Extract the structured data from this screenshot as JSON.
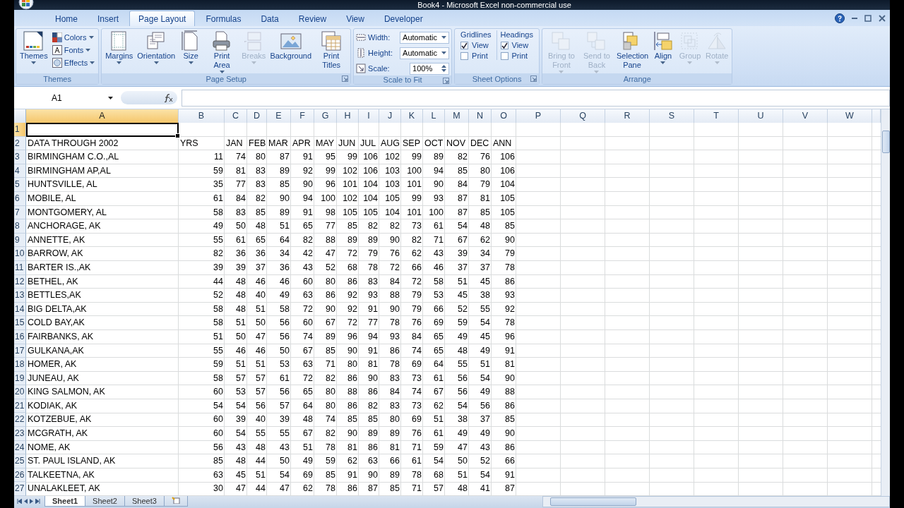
{
  "window": {
    "title": "Book4 - Microsoft Excel non-commercial use"
  },
  "ribbon_tabs": [
    {
      "label": "Home",
      "selected": false
    },
    {
      "label": "Insert",
      "selected": false
    },
    {
      "label": "Page Layout",
      "selected": true
    },
    {
      "label": "Formulas",
      "selected": false
    },
    {
      "label": "Data",
      "selected": false
    },
    {
      "label": "Review",
      "selected": false
    },
    {
      "label": "View",
      "selected": false
    },
    {
      "label": "Developer",
      "selected": false
    }
  ],
  "ribbon_groups": [
    {
      "title": "Themes",
      "launcher": false,
      "controls": [
        {
          "kind": "large",
          "label": "Themes",
          "dropdown": true,
          "disabled": false
        },
        {
          "kind": "stack",
          "items": [
            {
              "label": "Colors",
              "dropdown": true,
              "disabled": false
            },
            {
              "label": "Fonts",
              "dropdown": true,
              "disabled": false
            },
            {
              "label": "Effects",
              "dropdown": true,
              "disabled": false
            }
          ]
        }
      ]
    },
    {
      "title": "Page Setup",
      "launcher": true,
      "controls": [
        {
          "kind": "large",
          "label": "Margins",
          "dropdown": true,
          "disabled": false
        },
        {
          "kind": "large",
          "label": "Orientation",
          "dropdown": true,
          "disabled": false
        },
        {
          "kind": "large",
          "label": "Size",
          "dropdown": true,
          "disabled": false
        },
        {
          "kind": "large",
          "label": "Print Area",
          "dropdown": true,
          "disabled": false
        },
        {
          "kind": "large",
          "label": "Breaks",
          "dropdown": true,
          "disabled": true
        },
        {
          "kind": "large",
          "label": "Background",
          "dropdown": false,
          "disabled": false
        },
        {
          "kind": "large",
          "label": "Print Titles",
          "dropdown": false,
          "disabled": false
        }
      ]
    },
    {
      "title": "Scale to Fit",
      "launcher": true,
      "controls": [
        {
          "kind": "fields",
          "items": [
            {
              "label": "Width:",
              "value": "Automatic",
              "kind": "dropdown"
            },
            {
              "label": "Height:",
              "value": "Automatic",
              "kind": "dropdown"
            },
            {
              "label": "Scale:",
              "value": "100%",
              "kind": "spin"
            }
          ]
        }
      ]
    },
    {
      "title": "Sheet Options",
      "launcher": true,
      "controls": [
        {
          "kind": "checks",
          "title": "Gridlines",
          "options": [
            {
              "label": "View",
              "checked": true
            },
            {
              "label": "Print",
              "checked": false
            }
          ]
        },
        {
          "kind": "checks",
          "title": "Headings",
          "options": [
            {
              "label": "View",
              "checked": true
            },
            {
              "label": "Print",
              "checked": false
            }
          ]
        }
      ]
    },
    {
      "title": "Arrange",
      "launcher": false,
      "controls": [
        {
          "kind": "large",
          "label": "Bring to Front",
          "dropdown": true,
          "disabled": true
        },
        {
          "kind": "large",
          "label": "Send to Back",
          "dropdown": true,
          "disabled": true
        },
        {
          "kind": "large",
          "label": "Selection Pane",
          "dropdown": false,
          "disabled": false
        },
        {
          "kind": "large",
          "label": "Align",
          "dropdown": true,
          "disabled": false
        },
        {
          "kind": "large",
          "label": "Group",
          "dropdown": true,
          "disabled": true
        },
        {
          "kind": "large",
          "label": "Rotate",
          "dropdown": true,
          "disabled": true
        }
      ]
    }
  ],
  "formula_bar": {
    "name_box": "A1"
  },
  "columns": [
    {
      "label": "A",
      "selected": true
    },
    {
      "label": "B",
      "selected": false
    },
    {
      "label": "C",
      "selected": false
    },
    {
      "label": "D",
      "selected": false
    },
    {
      "label": "E",
      "selected": false
    },
    {
      "label": "F",
      "selected": false
    },
    {
      "label": "G",
      "selected": false
    },
    {
      "label": "H",
      "selected": false
    },
    {
      "label": "I",
      "selected": false
    },
    {
      "label": "J",
      "selected": false
    },
    {
      "label": "K",
      "selected": false
    },
    {
      "label": "L",
      "selected": false
    },
    {
      "label": "M",
      "selected": false
    },
    {
      "label": "N",
      "selected": false
    },
    {
      "label": "O",
      "selected": false
    },
    {
      "label": "P",
      "selected": false
    },
    {
      "label": "Q",
      "selected": false
    },
    {
      "label": "R",
      "selected": false
    },
    {
      "label": "S",
      "selected": false
    },
    {
      "label": "T",
      "selected": false
    },
    {
      "label": "U",
      "selected": false
    },
    {
      "label": "V",
      "selected": false
    },
    {
      "label": "W",
      "selected": false
    }
  ],
  "rows": [
    {
      "number": "1",
      "selected": true,
      "kind": "blank"
    },
    {
      "number": "2",
      "selected": false,
      "kind": "header",
      "cells": [
        "DATA THROUGH 2002",
        "YRS",
        "JAN",
        "FEB",
        "MAR",
        "APR",
        "MAY",
        "JUN",
        "JUL",
        "AUG",
        "SEP",
        "OCT",
        "NOV",
        "DEC",
        "ANN"
      ]
    },
    {
      "number": "3",
      "selected": false,
      "kind": "data",
      "cells": [
        "BIRMINGHAM C.O.,AL",
        "11",
        "74",
        "80",
        "87",
        "91",
        "95",
        "99",
        "106",
        "102",
        "99",
        "89",
        "82",
        "76",
        "106"
      ]
    },
    {
      "number": "4",
      "selected": false,
      "kind": "data",
      "cells": [
        "BIRMINGHAM AP,AL",
        "59",
        "81",
        "83",
        "89",
        "92",
        "99",
        "102",
        "106",
        "103",
        "100",
        "94",
        "85",
        "80",
        "106"
      ]
    },
    {
      "number": "5",
      "selected": false,
      "kind": "data",
      "cells": [
        "HUNTSVILLE, AL",
        "35",
        "77",
        "83",
        "85",
        "90",
        "96",
        "101",
        "104",
        "103",
        "101",
        "90",
        "84",
        "79",
        "104"
      ]
    },
    {
      "number": "6",
      "selected": false,
      "kind": "data",
      "cells": [
        "MOBILE, AL",
        "61",
        "84",
        "82",
        "90",
        "94",
        "100",
        "102",
        "104",
        "105",
        "99",
        "93",
        "87",
        "81",
        "105"
      ]
    },
    {
      "number": "7",
      "selected": false,
      "kind": "data",
      "cells": [
        "MONTGOMERY, AL",
        "58",
        "83",
        "85",
        "89",
        "91",
        "98",
        "105",
        "105",
        "104",
        "101",
        "100",
        "87",
        "85",
        "105"
      ]
    },
    {
      "number": "8",
      "selected": false,
      "kind": "data",
      "cells": [
        "ANCHORAGE, AK",
        "49",
        "50",
        "48",
        "51",
        "65",
        "77",
        "85",
        "82",
        "82",
        "73",
        "61",
        "54",
        "48",
        "85"
      ]
    },
    {
      "number": "9",
      "selected": false,
      "kind": "data",
      "cells": [
        "ANNETTE, AK",
        "55",
        "61",
        "65",
        "64",
        "82",
        "88",
        "89",
        "89",
        "90",
        "82",
        "71",
        "67",
        "62",
        "90"
      ]
    },
    {
      "number": "10",
      "selected": false,
      "kind": "data",
      "cells": [
        "BARROW, AK",
        "82",
        "36",
        "36",
        "34",
        "42",
        "47",
        "72",
        "79",
        "76",
        "62",
        "43",
        "39",
        "34",
        "79"
      ]
    },
    {
      "number": "11",
      "selected": false,
      "kind": "data",
      "cells": [
        "BARTER IS.,AK",
        "39",
        "39",
        "37",
        "36",
        "43",
        "52",
        "68",
        "78",
        "72",
        "66",
        "46",
        "37",
        "37",
        "78"
      ]
    },
    {
      "number": "12",
      "selected": false,
      "kind": "data",
      "cells": [
        "BETHEL, AK",
        "44",
        "48",
        "46",
        "46",
        "60",
        "80",
        "86",
        "83",
        "84",
        "72",
        "58",
        "51",
        "45",
        "86"
      ]
    },
    {
      "number": "13",
      "selected": false,
      "kind": "data",
      "cells": [
        "BETTLES,AK",
        "52",
        "48",
        "40",
        "49",
        "63",
        "86",
        "92",
        "93",
        "88",
        "79",
        "53",
        "45",
        "38",
        "93"
      ]
    },
    {
      "number": "14",
      "selected": false,
      "kind": "data",
      "cells": [
        "BIG DELTA,AK",
        "58",
        "48",
        "51",
        "58",
        "72",
        "90",
        "92",
        "91",
        "90",
        "79",
        "66",
        "52",
        "55",
        "92"
      ]
    },
    {
      "number": "15",
      "selected": false,
      "kind": "data",
      "cells": [
        "COLD BAY,AK",
        "58",
        "51",
        "50",
        "56",
        "60",
        "67",
        "72",
        "77",
        "78",
        "76",
        "69",
        "59",
        "54",
        "78"
      ]
    },
    {
      "number": "16",
      "selected": false,
      "kind": "data",
      "cells": [
        "FAIRBANKS, AK",
        "51",
        "50",
        "47",
        "56",
        "74",
        "89",
        "96",
        "94",
        "93",
        "84",
        "65",
        "49",
        "45",
        "96"
      ]
    },
    {
      "number": "17",
      "selected": false,
      "kind": "data",
      "cells": [
        "GULKANA,AK",
        "55",
        "46",
        "46",
        "50",
        "67",
        "85",
        "90",
        "91",
        "86",
        "74",
        "65",
        "48",
        "49",
        "91"
      ]
    },
    {
      "number": "18",
      "selected": false,
      "kind": "data",
      "cells": [
        "HOMER, AK",
        "59",
        "51",
        "51",
        "53",
        "63",
        "71",
        "80",
        "81",
        "78",
        "69",
        "64",
        "55",
        "51",
        "81"
      ]
    },
    {
      "number": "19",
      "selected": false,
      "kind": "data",
      "cells": [
        "JUNEAU, AK",
        "58",
        "57",
        "57",
        "61",
        "72",
        "82",
        "86",
        "90",
        "83",
        "73",
        "61",
        "56",
        "54",
        "90"
      ]
    },
    {
      "number": "20",
      "selected": false,
      "kind": "data",
      "cells": [
        "KING SALMON, AK",
        "60",
        "53",
        "57",
        "56",
        "65",
        "80",
        "88",
        "86",
        "84",
        "74",
        "67",
        "56",
        "49",
        "88"
      ]
    },
    {
      "number": "21",
      "selected": false,
      "kind": "data",
      "cells": [
        "KODIAK, AK",
        "54",
        "54",
        "56",
        "57",
        "64",
        "80",
        "86",
        "82",
        "83",
        "73",
        "62",
        "54",
        "56",
        "86"
      ]
    },
    {
      "number": "22",
      "selected": false,
      "kind": "data",
      "cells": [
        "KOTZEBUE, AK",
        "60",
        "39",
        "40",
        "39",
        "48",
        "74",
        "85",
        "85",
        "80",
        "69",
        "51",
        "38",
        "37",
        "85"
      ]
    },
    {
      "number": "23",
      "selected": false,
      "kind": "data",
      "cells": [
        "MCGRATH, AK",
        "60",
        "54",
        "55",
        "55",
        "67",
        "82",
        "90",
        "89",
        "89",
        "76",
        "61",
        "49",
        "49",
        "90"
      ]
    },
    {
      "number": "24",
      "selected": false,
      "kind": "data",
      "cells": [
        "NOME, AK",
        "56",
        "43",
        "48",
        "43",
        "51",
        "78",
        "81",
        "86",
        "81",
        "71",
        "59",
        "47",
        "43",
        "86"
      ]
    },
    {
      "number": "25",
      "selected": false,
      "kind": "data",
      "cells": [
        "ST. PAUL ISLAND, AK",
        "85",
        "48",
        "44",
        "50",
        "49",
        "59",
        "62",
        "63",
        "66",
        "61",
        "54",
        "50",
        "52",
        "66"
      ]
    },
    {
      "number": "26",
      "selected": false,
      "kind": "data",
      "cells": [
        "TALKEETNA, AK",
        "63",
        "45",
        "51",
        "54",
        "69",
        "85",
        "91",
        "90",
        "89",
        "78",
        "68",
        "51",
        "54",
        "91"
      ]
    },
    {
      "number": "27",
      "selected": false,
      "kind": "data",
      "cells": [
        "UNALAKLEET, AK",
        "30",
        "47",
        "44",
        "47",
        "62",
        "78",
        "86",
        "87",
        "85",
        "71",
        "57",
        "48",
        "41",
        "87"
      ]
    }
  ],
  "sheet_tabs": [
    {
      "label": "Sheet1",
      "selected": true
    },
    {
      "label": "Sheet2",
      "selected": false
    },
    {
      "label": "Sheet3",
      "selected": false
    }
  ]
}
